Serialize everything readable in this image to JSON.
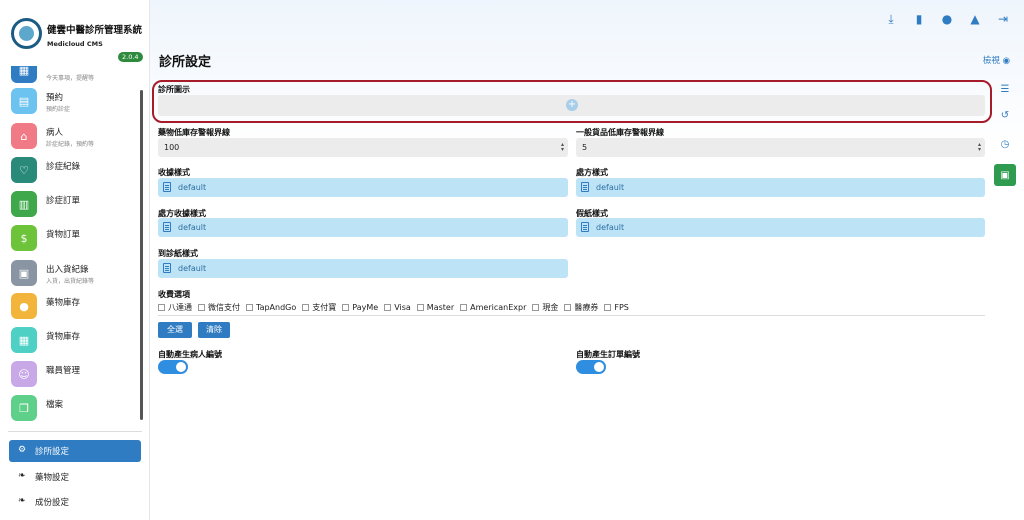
{
  "brand": {
    "title": "健雲中醫診所管理系統",
    "subtitle": "Medicloud CMS",
    "version": "2.0.4"
  },
  "sidebar": {
    "items": [
      {
        "label": "",
        "sub": "今天事項，提醒等",
        "color": "#2f7cc2",
        "icon": "calendar-icon"
      },
      {
        "label": "預約",
        "sub": "預約診症",
        "color": "#6cc3f0",
        "icon": "calendar-icon"
      },
      {
        "label": "病人",
        "sub": "診症紀錄，預約等",
        "color": "#f07a86",
        "icon": "bed-icon"
      },
      {
        "label": "診症紀錄",
        "sub": "",
        "color": "#2a8a7a",
        "icon": "stethoscope-icon"
      },
      {
        "label": "診症訂單",
        "sub": "",
        "color": "#3ea84a",
        "icon": "clipboard-icon"
      },
      {
        "label": "貨物訂單",
        "sub": "",
        "color": "#6dc33a",
        "icon": "invoice-icon"
      },
      {
        "label": "出入貨紀錄",
        "sub": "入貨，出貨紀錄等",
        "color": "#8a95a3",
        "icon": "warehouse-icon"
      },
      {
        "label": "藥物庫存",
        "sub": "",
        "color": "#f2b43a",
        "icon": "pills-icon"
      },
      {
        "label": "貨物庫存",
        "sub": "",
        "color": "#4fd0c4",
        "icon": "boxes-icon"
      },
      {
        "label": "職員管理",
        "sub": "",
        "color": "#c9a8e8",
        "icon": "staff-icon"
      },
      {
        "label": "檔案",
        "sub": "",
        "color": "#5fd08a",
        "icon": "files-icon"
      }
    ],
    "settings": [
      {
        "label": "診所設定",
        "active": true,
        "icon": "gears-icon"
      },
      {
        "label": "藥物設定",
        "active": false,
        "icon": "leaf-icon"
      },
      {
        "label": "成份設定",
        "active": false,
        "icon": "leaf-icon"
      }
    ]
  },
  "header": {
    "title": "診所設定",
    "view_link": "檢視"
  },
  "form": {
    "logo_label": "診所圖示",
    "drug_threshold_label": "藥物低庫存警報界線",
    "drug_threshold_value": "100",
    "goods_threshold_label": "一般貨品低庫存警報界線",
    "goods_threshold_value": "5",
    "receipt_style_label": "收據樣式",
    "receipt_style_value": "default",
    "prescription_style_label": "處方樣式",
    "prescription_style_value": "default",
    "rx_receipt_style_label": "處方收據樣式",
    "rx_receipt_style_value": "default",
    "leave_style_label": "假紙樣式",
    "leave_style_value": "default",
    "attendance_style_label": "到診紙樣式",
    "attendance_style_value": "default",
    "payment_label": "收費選項",
    "payment_options": [
      "八達通",
      "微信支付",
      "TapAndGo",
      "支付寶",
      "PayMe",
      "Visa",
      "Master",
      "AmericanExpr",
      "現金",
      "醫療券",
      "FPS"
    ],
    "select_all": "全選",
    "clear": "清除",
    "auto_patient_label": "自動產生病人編號",
    "auto_order_label": "自動產生訂單編號"
  }
}
